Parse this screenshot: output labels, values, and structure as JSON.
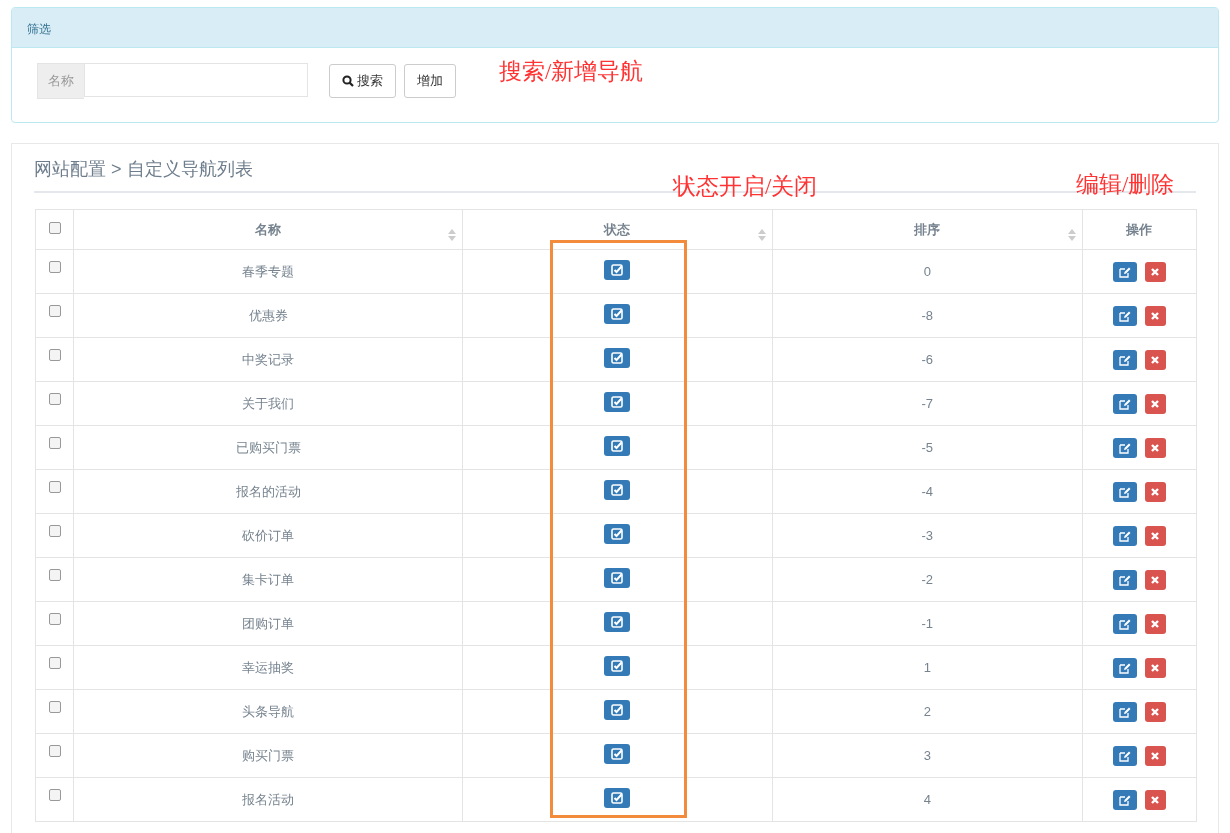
{
  "filter_panel": {
    "title": "筛选",
    "name_field": {
      "addon": "名称"
    },
    "buttons": [
      {
        "kind": "search",
        "label": "搜索"
      },
      {
        "kind": "plain",
        "label": "增加"
      }
    ]
  },
  "list_panel": {
    "breadcrumb": "网站配置 > 自定义导航列表",
    "table": {
      "columns": [
        {
          "label": "名称",
          "sortable": true
        },
        {
          "label": "状态",
          "sortable": true
        },
        {
          "label": "排序",
          "sortable": true
        },
        {
          "label": "操作",
          "sortable": false
        }
      ],
      "header_checked": false,
      "rows": [
        {
          "checked": false,
          "name": "春季专题",
          "enabled": true,
          "order": "0"
        },
        {
          "checked": false,
          "name": "优惠券",
          "enabled": true,
          "order": "-8"
        },
        {
          "checked": false,
          "name": "中奖记录",
          "enabled": true,
          "order": "-6"
        },
        {
          "checked": false,
          "name": "关于我们",
          "enabled": true,
          "order": "-7"
        },
        {
          "checked": false,
          "name": "已购买门票",
          "enabled": true,
          "order": "-5"
        },
        {
          "checked": false,
          "name": "报名的活动",
          "enabled": true,
          "order": "-4"
        },
        {
          "checked": false,
          "name": "砍价订单",
          "enabled": true,
          "order": "-3"
        },
        {
          "checked": false,
          "name": "集卡订单",
          "enabled": true,
          "order": "-2"
        },
        {
          "checked": false,
          "name": "团购订单",
          "enabled": true,
          "order": "-1"
        },
        {
          "checked": false,
          "name": "幸运抽奖",
          "enabled": true,
          "order": "1"
        },
        {
          "checked": false,
          "name": "头条导航",
          "enabled": true,
          "order": "2"
        },
        {
          "checked": false,
          "name": "购买门票",
          "enabled": true,
          "order": "3"
        },
        {
          "checked": false,
          "name": "报名活动",
          "enabled": true,
          "order": "4"
        }
      ]
    }
  },
  "annotations": [
    {
      "kind": "text",
      "text": "搜索/新增导航"
    },
    {
      "kind": "text",
      "text": "状态开启/关闭"
    },
    {
      "kind": "text",
      "text": "编辑/删除"
    },
    {
      "kind": "frame"
    }
  ]
}
